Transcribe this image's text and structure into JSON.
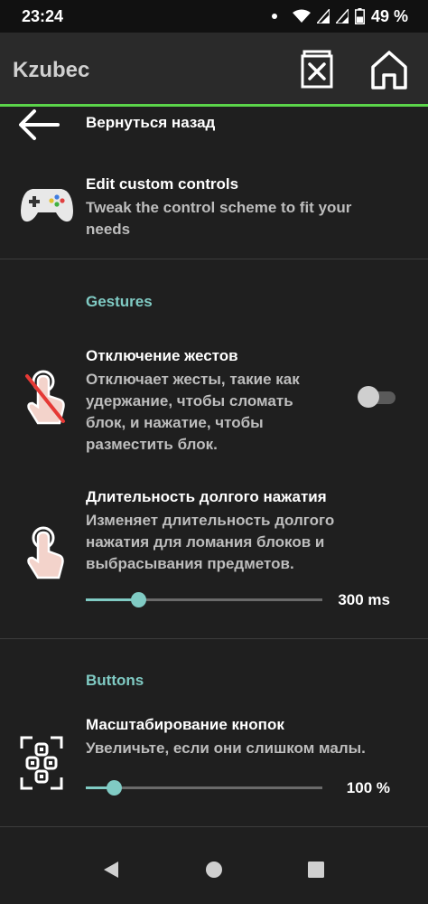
{
  "status": {
    "time": "23:24",
    "battery": "49 %"
  },
  "appbar": {
    "title": "Kzubec",
    "delete_icon": "trash-x-icon",
    "home_icon": "home-icon"
  },
  "back": {
    "label": "Вернуться назад",
    "icon": "arrow-left-icon"
  },
  "custom_controls": {
    "title": "Edit custom controls",
    "subtitle_lines": [
      "Tweak the control scheme to fit your",
      "needs"
    ],
    "icon": "gamepad-icon"
  },
  "gestures": {
    "header": "Gestures",
    "disable": {
      "title": "Отключение жестов",
      "subtitle_lines": [
        "Отключает жесты, такие как",
        "удержание, чтобы сломать",
        "блок, и нажатие, чтобы",
        "разместить блок."
      ],
      "icon": "touch-disabled-icon",
      "enabled": false
    },
    "long_press": {
      "title": "Длительность долгого нажатия",
      "subtitle_lines": [
        "Изменяет длительность долгого",
        "нажатия для ломания блоков и",
        "выбрасывания предметов."
      ],
      "icon": "touch-icon",
      "value_label": "300 ms",
      "fraction": 0.22
    }
  },
  "buttons": {
    "header": "Buttons",
    "scale": {
      "title": "Масштабирование кнопок",
      "subtitle_lines": [
        "Увеличьте, если они слишком малы."
      ],
      "icon": "dpad-scale-icon",
      "value_label": "100 %",
      "fraction": 0.12
    }
  },
  "navbar": {
    "back_icon": "nav-back-icon",
    "home_icon": "nav-home-icon",
    "recents_icon": "nav-recents-icon"
  },
  "colors": {
    "accent": "#80cbc4",
    "appbar_underline": "#5bd44a",
    "background": "#1f1f1f"
  }
}
